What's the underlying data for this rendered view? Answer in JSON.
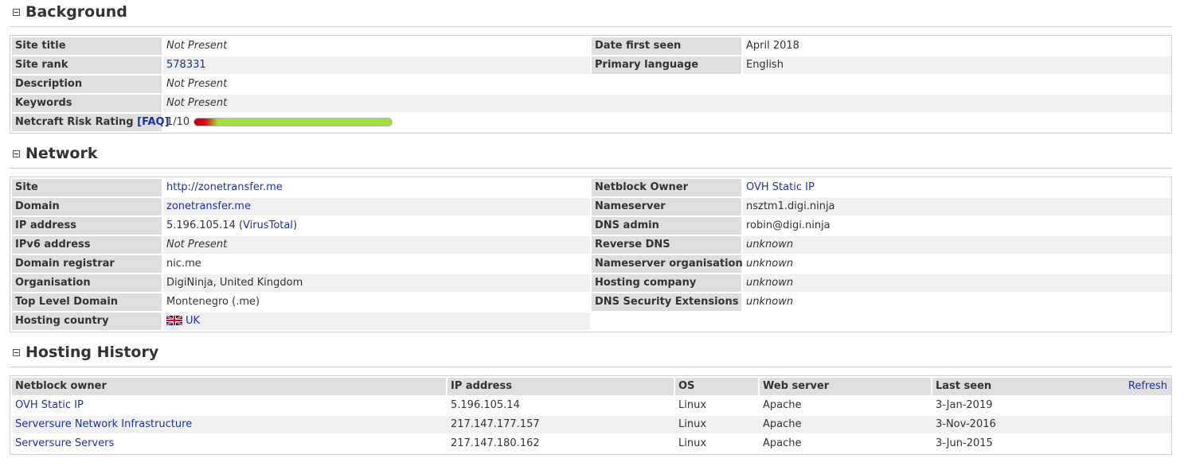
{
  "background": {
    "title": "Background",
    "rows": [
      {
        "label": "Site title",
        "value": "Not Present",
        "label2": "Date first seen",
        "value2": "April 2018"
      },
      {
        "label": "Site rank",
        "value": "578331",
        "label2": "Primary language",
        "value2": "English"
      },
      {
        "label": "Description",
        "value": "Not Present"
      },
      {
        "label": "Keywords",
        "value": "Not Present"
      },
      {
        "label": "Netcraft Risk Rating",
        "faq": "[FAQ]",
        "value": "1/10",
        "risk_fraction": 0.1
      }
    ]
  },
  "network": {
    "title": "Network",
    "rows": [
      {
        "label": "Site",
        "value": "http://zonetransfer.me",
        "label2": "Netblock Owner",
        "value2": "OVH Static IP"
      },
      {
        "label": "Domain",
        "value": "zonetransfer.me",
        "label2": "Nameserver",
        "value2": "nsztm1.digi.ninja"
      },
      {
        "label": "IP address",
        "value": "5.196.105.14 (",
        "link": "VirusTotal",
        "after": ")",
        "label2": "DNS admin",
        "value2": "robin@digi.ninja"
      },
      {
        "label": "IPv6 address",
        "value": "Not Present",
        "label2": "Reverse DNS",
        "value2": "unknown"
      },
      {
        "label": "Domain registrar",
        "value": "nic.me",
        "label2": "Nameserver organisation",
        "value2": "unknown"
      },
      {
        "label": "Organisation",
        "value": "DigiNinja, United Kingdom",
        "label2": "Hosting company",
        "value2": "unknown"
      },
      {
        "label": "Top Level Domain",
        "value": "Montenegro (.me)",
        "label2": "DNS Security Extensions",
        "value2": "unknown"
      },
      {
        "label": "Hosting country",
        "value": "UK",
        "flag_icon": "uk-flag-icon"
      }
    ]
  },
  "hosting_history": {
    "title": "Hosting History",
    "headers": [
      "Netblock owner",
      "IP address",
      "OS",
      "Web server",
      "Last seen"
    ],
    "refresh_label": "Refresh",
    "rows": [
      [
        "OVH Static IP",
        "5.196.105.14",
        "Linux",
        "Apache",
        "3-Jan-2019"
      ],
      [
        "Serversure Network Infrastructure",
        "217.147.177.157",
        "Linux",
        "Apache",
        "3-Nov-2016"
      ],
      [
        "Serversure Servers",
        "217.147.180.162",
        "Linux",
        "Apache",
        "3-Jun-2015"
      ]
    ]
  },
  "colors": {
    "link": "#1b32a0",
    "label_bg": "#dedede",
    "alt_row_bg": "#f0f0f0",
    "risk_low": "#9fe040",
    "risk_high": "#c00000"
  }
}
